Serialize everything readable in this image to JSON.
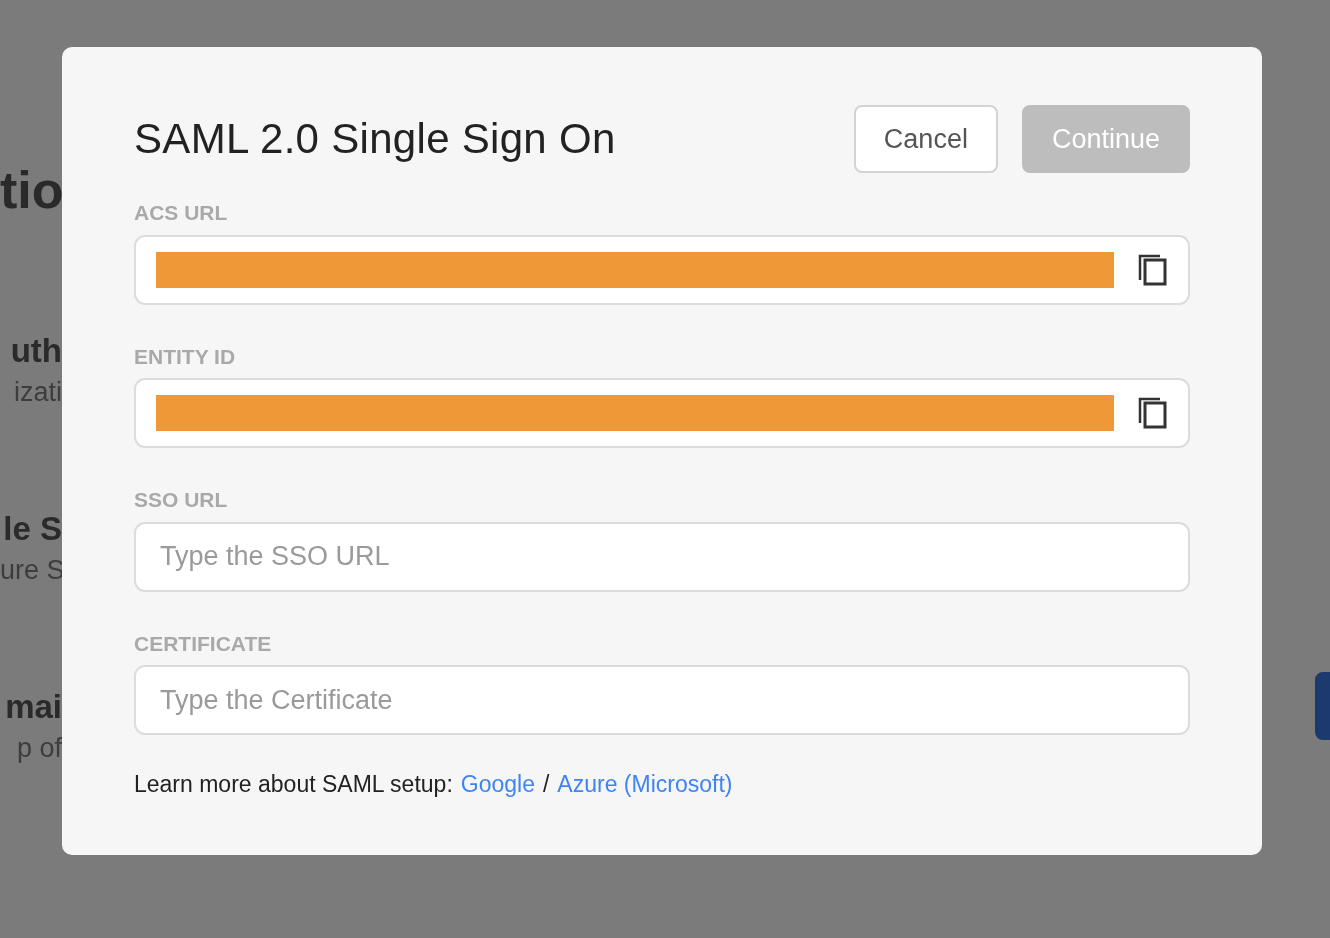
{
  "background": {
    "texts": [
      {
        "text": "tio",
        "kind": "heading"
      },
      {
        "text": "uth",
        "kind": "title"
      },
      {
        "text": "izati",
        "kind": "subtitle"
      },
      {
        "text": "le S",
        "kind": "title"
      },
      {
        "text": "ure S",
        "kind": "subtitle"
      },
      {
        "text": "mai",
        "kind": "title"
      },
      {
        "text": "p of",
        "kind": "subtitle"
      }
    ]
  },
  "modal": {
    "title": "SAML 2.0 Single Sign On",
    "buttons": [
      {
        "label": "Cancel",
        "kind": "secondary",
        "disabled": false
      },
      {
        "label": "Continue",
        "kind": "primary",
        "disabled": true
      }
    ],
    "fields": [
      {
        "label": "ACS URL",
        "kind": "copy"
      },
      {
        "label": "ENTITY ID",
        "kind": "copy"
      },
      {
        "label": "SSO URL",
        "kind": "input",
        "placeholder": "Type the SSO URL"
      },
      {
        "label": "CERTIFICATE",
        "kind": "input",
        "placeholder": "Type the Certificate"
      }
    ],
    "help": {
      "text": "Learn more about SAML setup:",
      "links": [
        {
          "label": "Google"
        },
        {
          "label": "Azure (Microsoft)"
        }
      ],
      "separator": "/"
    }
  }
}
